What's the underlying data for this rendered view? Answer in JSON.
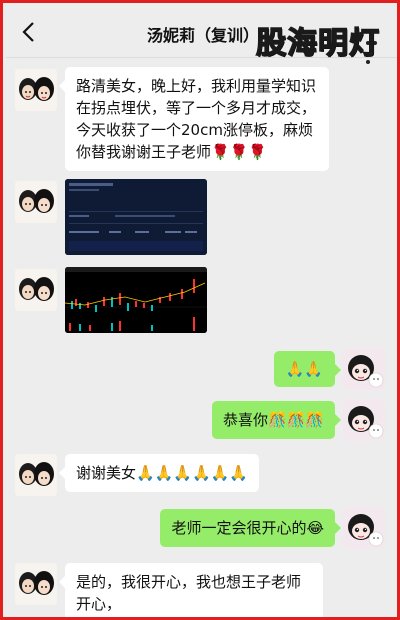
{
  "header": {
    "title": "汤妮莉（复训）",
    "back_icon": "chevron-left-icon",
    "more_icon": "more-dots-icon"
  },
  "watermark": "股海明灯",
  "messages": [
    {
      "side": "in",
      "type": "text",
      "text": "路清美女，晚上好，我利用量学知识在拐点埋伏，等了一个多月才成交，今天收获了一个20cm涨停板，麻烦你替我谢谢王子老师🌹🌹🌹"
    },
    {
      "side": "in",
      "type": "image",
      "description": "trading-order-screenshot"
    },
    {
      "side": "in",
      "type": "image",
      "description": "candlestick-chart-screenshot"
    },
    {
      "side": "out",
      "type": "text",
      "text": "🙏🙏"
    },
    {
      "side": "out",
      "type": "text",
      "text": "恭喜你🎊🎊🎊"
    },
    {
      "side": "in",
      "type": "text",
      "text": "谢谢美女🙏🙏🙏🙏🙏🙏"
    },
    {
      "side": "out",
      "type": "text",
      "text": "老师一定会很开心的😂"
    },
    {
      "side": "in",
      "type": "text",
      "text": "是的，我很开心，我也想王子老师开心，"
    }
  ],
  "colors": {
    "frame": "#e0201e",
    "background": "#ededed",
    "bubble_in": "#ffffff",
    "bubble_out": "#95ec69"
  }
}
